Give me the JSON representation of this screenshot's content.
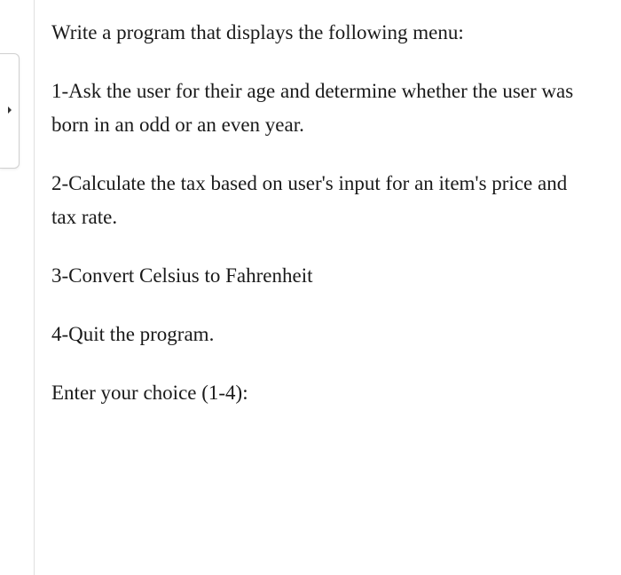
{
  "paragraphs": {
    "p1": "Write a program that displays the following menu:",
    "p2": "1-Ask the user for their age and determine whether the user was born in an odd or an even year.",
    "p3": "2-Calculate the tax based on user's input for an item's price and tax rate.",
    "p4": "3-Convert Celsius to Fahrenheit",
    "p5": "4-Quit the program.",
    "p6": "Enter your choice (1-4):"
  }
}
